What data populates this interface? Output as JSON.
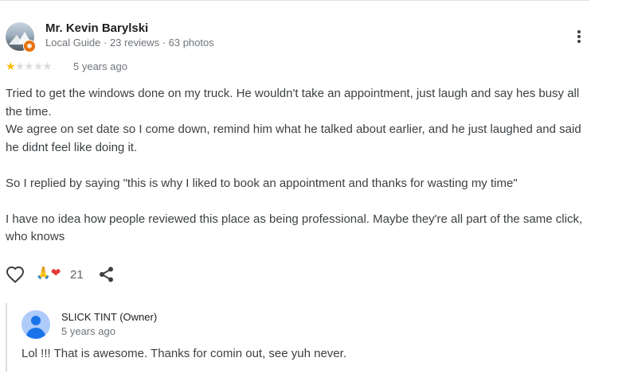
{
  "review": {
    "reviewer_name": "Mr. Kevin Barylski",
    "reviewer_meta": "Local Guide · 23 reviews · 63 photos",
    "rating": 1,
    "rating_max": 5,
    "star_filled": "★",
    "star_empty": "★",
    "time_ago": "5 years ago",
    "text_lines": [
      "Tried to get the windows done on my truck. He wouldn't take an appointment, just laugh and say hes busy all the time.",
      "We agree on set date so I come down, remind him what he talked about earlier, and he just laughed and said he didnt feel like doing it.",
      "",
      "So I replied by saying \"this is why I liked to book an appointment and thanks for wasting my time\"",
      "",
      "I have no idea how people reviewed this place as being professional. Maybe they're all part of the same click, who knows"
    ],
    "reactions": {
      "emojis": [
        "🙏",
        "❤"
      ],
      "count": "21"
    },
    "icons": {
      "avatar": "profile-photo-icon",
      "badge": "local-guide-badge-icon",
      "more": "more-vert-icon",
      "like": "heart-outline-icon",
      "share": "share-icon"
    },
    "colors": {
      "star": "#fbbc04",
      "star_empty": "#dadce0",
      "badge": "#e8710a",
      "owner_avatar": "#1a73e8"
    }
  },
  "owner_reply": {
    "name": "SLICK TINT (Owner)",
    "time_ago": "5 years ago",
    "text": "Lol !!! That is awesome. Thanks for comin out, see yuh never.",
    "avatar_icon": "person-icon"
  }
}
